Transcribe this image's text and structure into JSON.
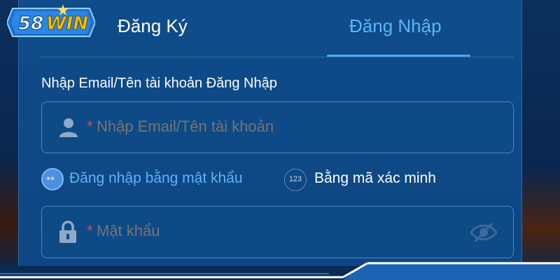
{
  "brand": {
    "logo_text": "58WIN"
  },
  "tabs": [
    {
      "label": "Đăng Ký",
      "active": false
    },
    {
      "label": "Đăng Nhập",
      "active": true
    }
  ],
  "username": {
    "label": "Nhập Email/Tên tài khoản Đăng Nhập",
    "required_mark": "*",
    "placeholder": "Nhập Email/Tên tài khoản"
  },
  "login_methods": {
    "password_label": "Đăng nhập bằng mật khẩu",
    "code_icon_text": "123",
    "code_label": "Bằng mã xác minh"
  },
  "password": {
    "required_mark": "*",
    "placeholder": "Mật khẩu"
  },
  "colors": {
    "panel": "#0f4c8a",
    "accent": "#5db4f6",
    "required": "#e8453c",
    "logo_yellow": "#f5c400"
  },
  "icons": [
    "user-icon",
    "lock-icon",
    "eye-off-icon",
    "password-dots-icon"
  ]
}
